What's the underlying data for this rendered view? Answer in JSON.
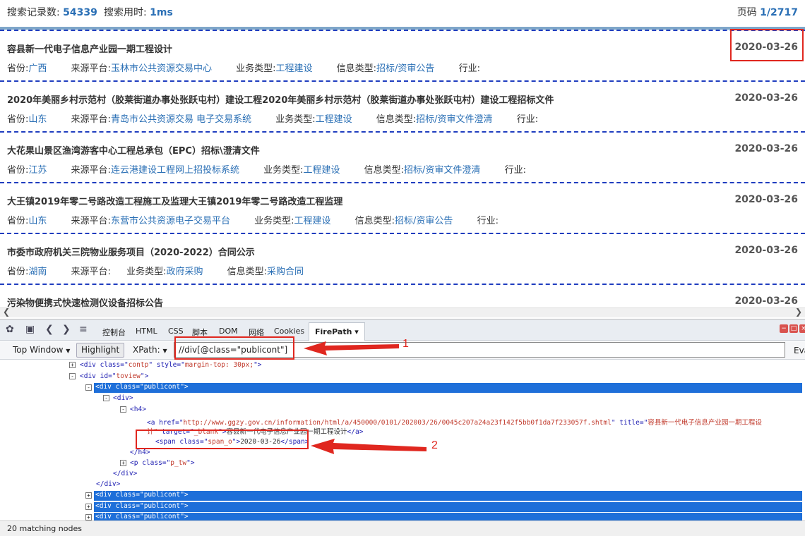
{
  "header": {
    "records_label": "搜索记录数:",
    "records_value": "54339",
    "time_label": "搜索用时:",
    "time_value": "1ms",
    "page_label": "页码",
    "page_value": "1/2717"
  },
  "results": [
    {
      "title": "容县新一代电子信息产业园一期工程设计",
      "date": "2020-03-26",
      "province_label": "省份:",
      "province": "广西",
      "source_label": "来源平台:",
      "source": "玉林市公共资源交易中心",
      "biz_label": "业务类型:",
      "biz": "工程建设",
      "info_label": "信息类型:",
      "info": "招标/资审公告",
      "industry_label": "行业:"
    },
    {
      "title": "2020年美丽乡村示范村（胶莱街道办事处张跃屯村）建设工程2020年美丽乡村示范村（胶莱街道办事处张跃屯村）建设工程招标文件",
      "date": "2020-03-26",
      "province_label": "省份:",
      "province": "山东",
      "source_label": "来源平台:",
      "source": "青岛市公共资源交易 电子交易系统",
      "biz_label": "业务类型:",
      "biz": "工程建设",
      "info_label": "信息类型:",
      "info": "招标/资审文件澄清",
      "industry_label": "行业:"
    },
    {
      "title": "大花果山景区渔湾游客中心工程总承包（EPC）招标\\澄清文件",
      "date": "2020-03-26",
      "province_label": "省份:",
      "province": "江苏",
      "source_label": "来源平台:",
      "source": "连云港建设工程网上招投标系统",
      "biz_label": "业务类型:",
      "biz": "工程建设",
      "info_label": "信息类型:",
      "info": "招标/资审文件澄清",
      "industry_label": "行业:"
    },
    {
      "title": "大王镇2019年零二号路改造工程施工及监理大王镇2019年零二号路改造工程监理",
      "date": "2020-03-26",
      "province_label": "省份:",
      "province": "山东",
      "source_label": "来源平台:",
      "source": "东营市公共资源电子交易平台",
      "biz_label": "业务类型:",
      "biz": "工程建设",
      "info_label": "信息类型:",
      "info": "招标/资审公告",
      "industry_label": "行业:"
    },
    {
      "title": "市委市政府机关三院物业服务项目（2020-2022）合同公示",
      "date": "2020-03-26",
      "province_label": "省份:",
      "province": "湖南",
      "source_label": "来源平台:",
      "source": "",
      "biz_label": "业务类型:",
      "biz": "政府采购",
      "info_label": "信息类型:",
      "info": "采购合同",
      "industry_label": ""
    },
    {
      "title": "污染物便携式快速检测仪设备招标公告",
      "date": "2020-03-26"
    }
  ],
  "devtools": {
    "tabs": [
      "控制台",
      "HTML",
      "CSS",
      "脚本",
      "DOM",
      "网络",
      "Cookies"
    ],
    "active_tab": "FirePath ▾",
    "window_dropdown": "Top Window",
    "highlight_btn": "Highlight",
    "xpath_label": "XPath:",
    "xpath_value": "//div[@class=\"publicont\"]",
    "eval_label": "Eva",
    "status": "20 matching nodes"
  },
  "tree": {
    "contp_style": "margin-top: 30px;",
    "href": "http://www.ggzy.gov.cn/information/html/a/450000/0101/202003/26/0045c207a24a23f142f5bb0f1da7f233057f.shtml",
    "title_attr": "容县新一代电子信息产业园一期工程设",
    "title_attr_cont": "计\"",
    "link_text": "容县新一代电子信息产业园一期工程设计",
    "span_text": "2020-03-26",
    "labels": {
      "div": "div",
      "class": "class",
      "id": "id",
      "style": "style",
      "contp": "contp",
      "toview": "toview",
      "publicont": "publicont",
      "h4": "h4",
      "a": "a",
      "href_attr": "href",
      "title": "title",
      "target": "target",
      "blank": "_blank",
      "span": "span",
      "span_o": "span_o",
      "p": "p",
      "p_tw": "p_tw"
    }
  },
  "annotations": {
    "one": "1",
    "two": "2"
  },
  "colors": {
    "link": "#2a6fb5",
    "dash": "#1f3dbf",
    "annotation": "#e0271f",
    "selection": "#1e6fd9"
  }
}
